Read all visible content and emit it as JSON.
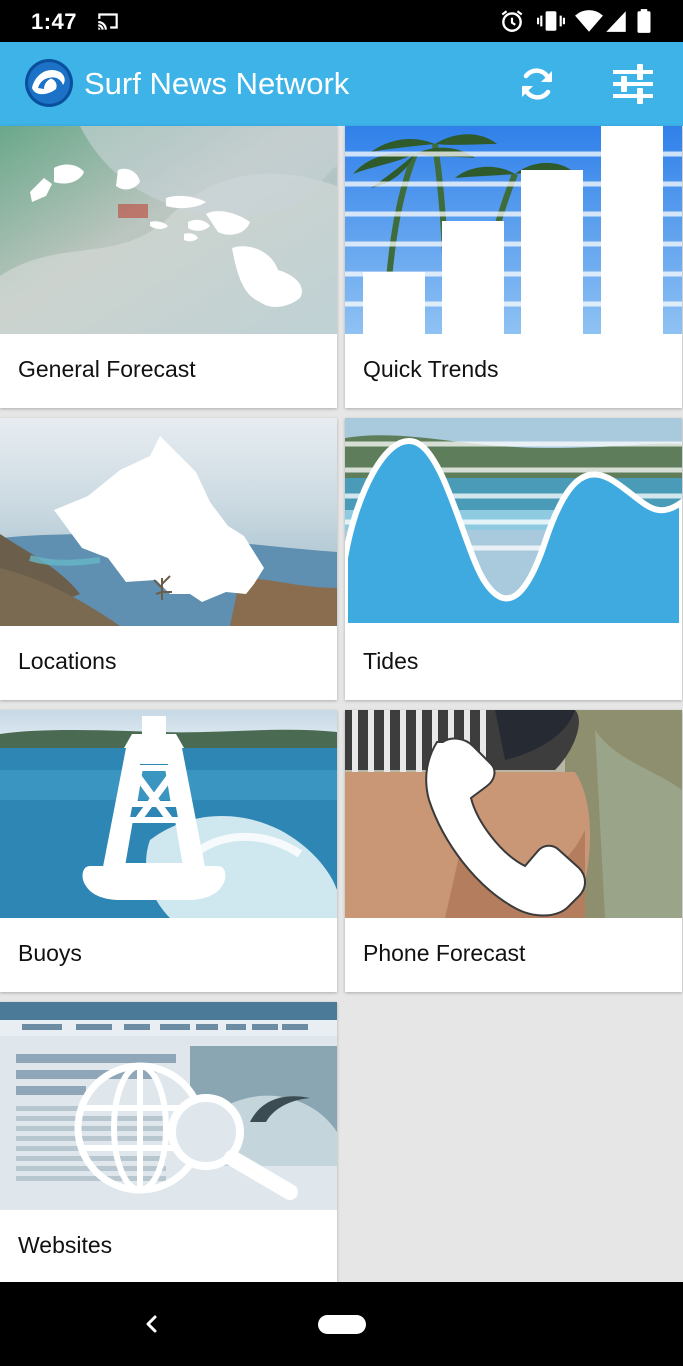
{
  "status_bar": {
    "time": "1:47",
    "icons": [
      "cast-icon",
      "alarm-icon",
      "vibrate-icon",
      "wifi-icon",
      "signal-icon",
      "battery-icon"
    ]
  },
  "app_bar": {
    "title": "Surf News Network",
    "actions": [
      "refresh-icon",
      "settings-sliders-icon"
    ],
    "accent_color": "#3db3e8"
  },
  "tiles": [
    {
      "label": "General Forecast",
      "icon": "hawaii-islands-icon"
    },
    {
      "label": "Quick Trends",
      "icon": "bar-chart-icon"
    },
    {
      "label": "Locations",
      "icon": "oahu-island-icon"
    },
    {
      "label": "Tides",
      "icon": "tide-wave-icon"
    },
    {
      "label": "Buoys",
      "icon": "buoy-icon"
    },
    {
      "label": "Phone Forecast",
      "icon": "phone-handset-icon"
    },
    {
      "label": "Websites",
      "icon": "globe-search-icon"
    }
  ],
  "nav_bar": {
    "icons": [
      "back-icon",
      "home-pill-icon"
    ]
  }
}
